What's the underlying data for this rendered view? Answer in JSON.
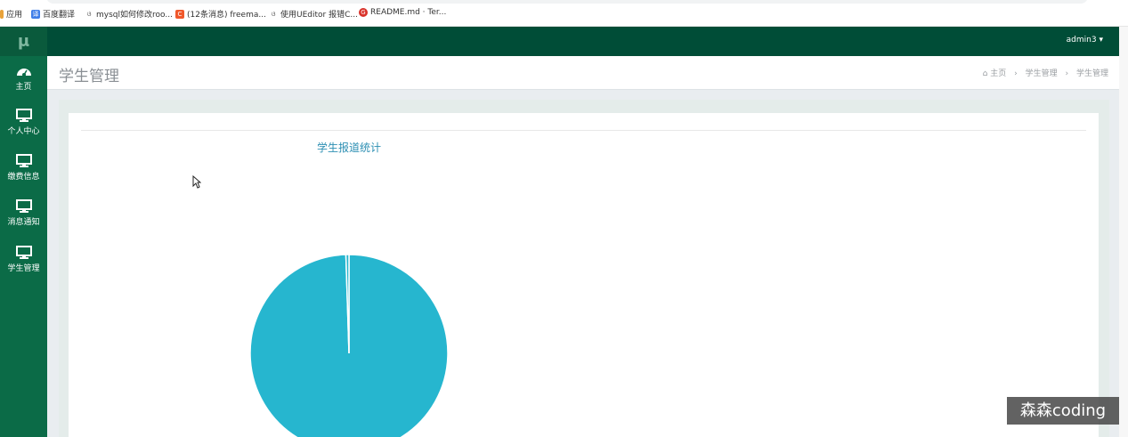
{
  "bookmarks": [
    {
      "label": "应用",
      "icon": "apps-icon"
    },
    {
      "label": "百度翻译",
      "icon": "translate-icon"
    },
    {
      "label": "mysql如何修改roo...",
      "icon": "bookmark-page-icon"
    },
    {
      "label": "(12条消息) freema...",
      "icon": "csdn-icon"
    },
    {
      "label": "使用UEditor 报错C...",
      "icon": "bookmark-page-icon"
    },
    {
      "label": "README.md · Ter...",
      "icon": "gitee-icon"
    }
  ],
  "logo": "μ",
  "sidebar": {
    "items": [
      {
        "label": "主页",
        "icon": "dashboard-icon"
      },
      {
        "label": "个人中心",
        "icon": "monitor-icon"
      },
      {
        "label": "缴费信息",
        "icon": "monitor-icon"
      },
      {
        "label": "消息通知",
        "icon": "monitor-icon"
      },
      {
        "label": "学生管理",
        "icon": "monitor-icon"
      }
    ]
  },
  "topbar": {
    "user": "admin3",
    "user_caret": "▾"
  },
  "header": {
    "title": "学生管理",
    "breadcrumb": {
      "home": "主页",
      "level1": "学生管理",
      "level2": "学生管理",
      "separator": "›"
    }
  },
  "colors": {
    "sidebar": "#0b6b47",
    "topbar": "#004d37",
    "pie": "#26b6cf",
    "title": "#2d8fb3"
  },
  "chart_data": {
    "type": "pie",
    "title": "学生报道统计",
    "values": [
      0.995,
      0.005
    ]
  },
  "watermark": "森森coding"
}
